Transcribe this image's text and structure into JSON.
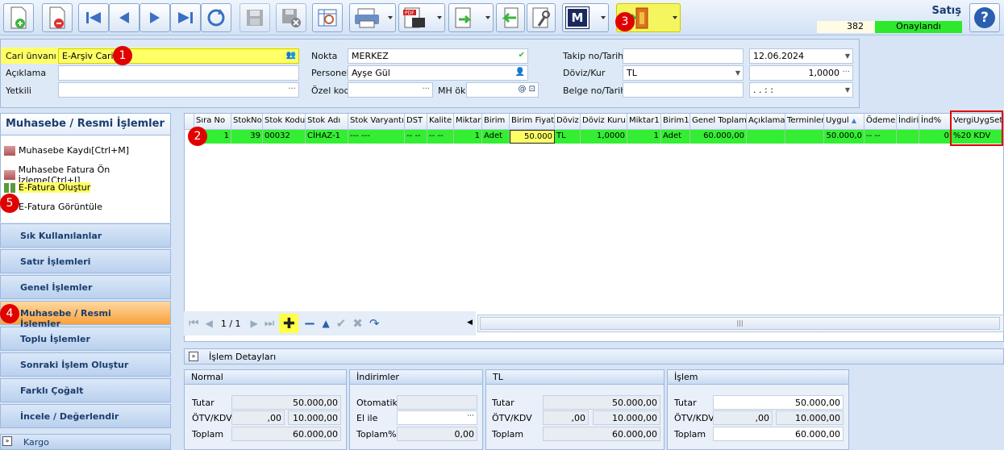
{
  "window": {
    "title": "Satış",
    "record_number": "382",
    "status": "Onaylandı",
    "help": "?"
  },
  "toolbar": {
    "buttons": [
      "new",
      "delete",
      "first",
      "previous",
      "next",
      "last",
      "refresh",
      "save",
      "cancel",
      "preview",
      "print",
      "pdf",
      "export",
      "back",
      "tools",
      "m-button",
      "exit"
    ],
    "m_label": "M",
    "accent": "#ffff66"
  },
  "badges": [
    "1",
    "2",
    "3",
    "4",
    "5"
  ],
  "form": {
    "cari_unvani_label": "Cari ünvanı",
    "cari_unvani_value": "E-Arşiv Carisi",
    "aciklama_label": "Açıklama",
    "yetkili_label": "Yetkili",
    "nokta_label": "Nokta",
    "nokta_value": "MERKEZ",
    "personel_label": "Personel",
    "personel_value": "Ayşe Gül",
    "ozel_kod_label": "Özel kod",
    "mh_ok_label": "MH ök",
    "takip_label": "Takip no/Tarih",
    "takip_date": "12.06.2024",
    "doviz_label": "Döviz/Kur",
    "doviz_value": "TL",
    "kur_value": "1,0000",
    "belge_label": "Belge no/Tarih",
    "belge_date": ".  .      :  :"
  },
  "left_panel": {
    "title": "Muhasebe / Resmi İşlemler",
    "items": [
      "Muhasebe Kaydı[Ctrl+M]",
      "Muhasebe Fatura Ön İzleme[Ctrl+I]",
      "E-Fatura Oluştur",
      "E-Fatura Görüntüle"
    ],
    "groups": [
      "Sık Kullanılanlar",
      "Satır İşlemleri",
      "Genel İşlemler",
      "Muhasebe / Resmi İşlemler",
      "Toplu İşlemler",
      "Sonraki İşlem Oluştur",
      "Farklı Çoğalt",
      "İncele / Değerlendir",
      "Kargo"
    ]
  },
  "grid": {
    "columns": [
      "Sıra No",
      "StokNo",
      "Stok Kodu",
      "Stok Adı",
      "Stok Varyantı",
      "DST",
      "Kalite",
      "Miktar",
      "Birim",
      "Birim Fiyat",
      "Döviz",
      "Döviz Kuru",
      "Miktar1",
      "Birim1",
      "Genel Toplam",
      "Açıklama",
      "Terminler",
      "Uygul",
      "Ödeme",
      "İndiri",
      "İnd%",
      "VergiUygSet"
    ],
    "row": [
      "1",
      "39",
      "00032",
      "CİHAZ-1",
      "--- ---",
      "-- --",
      "-- --",
      "1",
      "Adet",
      "50.000",
      "TL",
      "1,0000",
      "1",
      "Adet",
      "60.000,00",
      "",
      "",
      "50.000,0",
      "-- --",
      "",
      "0",
      "%20 KDV"
    ],
    "pager": "1 / 1"
  },
  "details": {
    "bar_label": "İşlem Detayları",
    "normal": {
      "title": "Normal",
      "tutar_label": "Tutar",
      "tutar": "50.000,00",
      "otv_label": "ÖTV/KDV",
      "otv": ",00",
      "kdv": "10.000,00",
      "toplam_label": "Toplam",
      "toplam": "60.000,00"
    },
    "indirimler": {
      "title": "İndirimler",
      "otomatik_label": "Otomatik",
      "otomatik": "",
      "elile_label": "El ile",
      "elile": "",
      "toplam_label": "Toplam%",
      "toplam": "0,00"
    },
    "tl": {
      "title": "TL",
      "tutar_label": "Tutar",
      "tutar": "50.000,00",
      "otv_label": "ÖTV/KDV",
      "otv": ",00",
      "kdv": "10.000,00",
      "toplam_label": "Toplam",
      "toplam": "60.000,00"
    },
    "islem": {
      "title": "İşlem",
      "tutar_label": "Tutar",
      "tutar": "50.000,00",
      "otv_label": "ÖTV/KDV",
      "otv": ",00",
      "kdv": "10.000,00",
      "toplam_label": "Toplam",
      "toplam": "60.000,00"
    }
  }
}
